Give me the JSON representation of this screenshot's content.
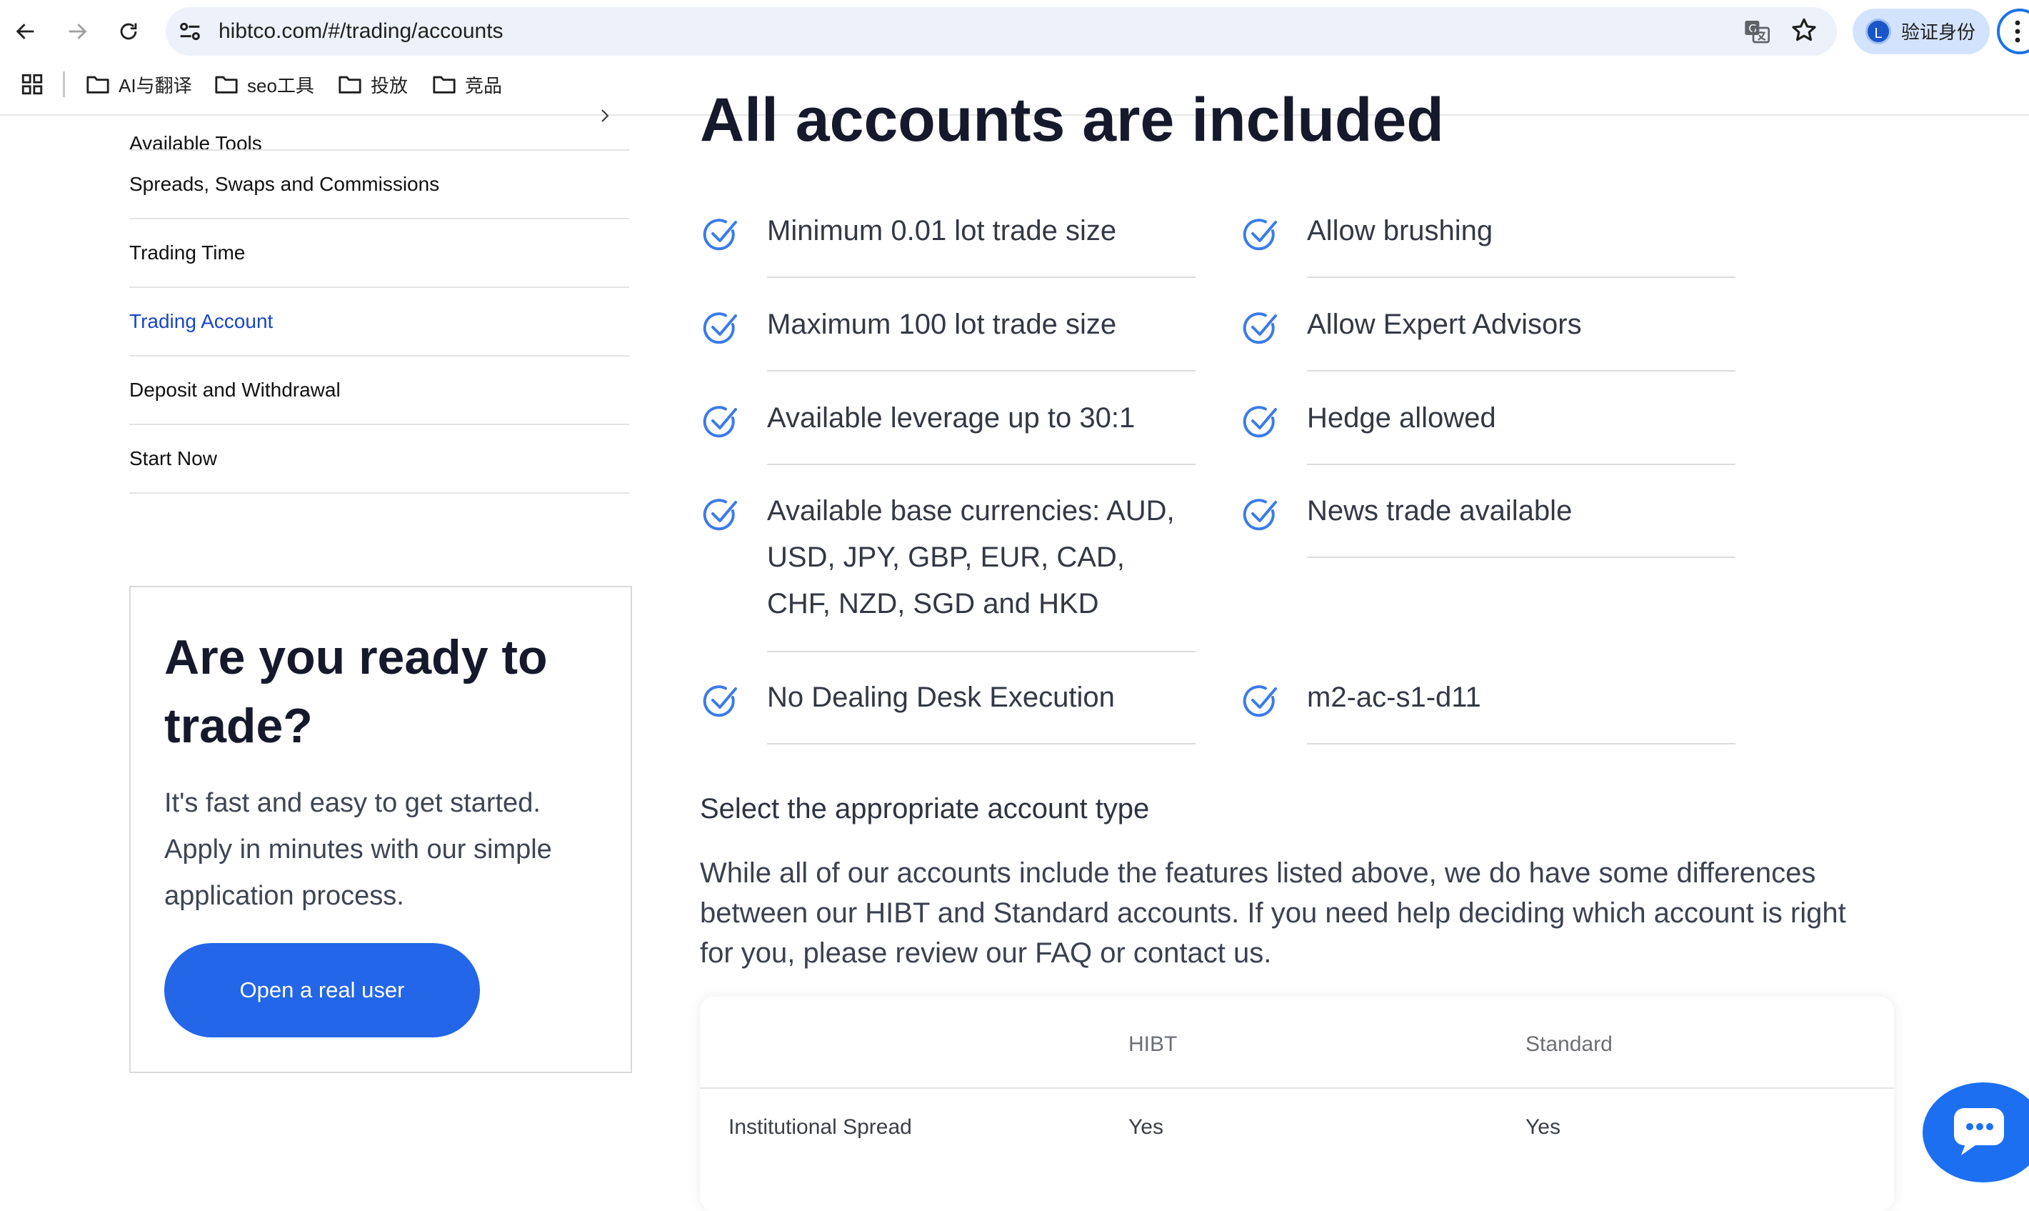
{
  "browser": {
    "url": "hibtco.com/#/trading/accounts",
    "profile_initial": "L",
    "profile_label": "验证身份",
    "bookmarks": [
      {
        "label": "AI与翻译"
      },
      {
        "label": "seo工具"
      },
      {
        "label": "投放"
      },
      {
        "label": "竞品"
      }
    ]
  },
  "sidebar": {
    "items": [
      {
        "label": "Available Tools"
      },
      {
        "label": "Spreads, Swaps and Commissions"
      },
      {
        "label": "Trading Time"
      },
      {
        "label": "Trading Account"
      },
      {
        "label": "Deposit and Withdrawal"
      },
      {
        "label": "Start Now"
      }
    ],
    "active_index": 3,
    "active_color": "#1846c8"
  },
  "cta": {
    "title": "Are you ready to trade?",
    "text": "It's fast and easy to get started. Apply in minutes with our simple application process.",
    "button": "Open a real user"
  },
  "main": {
    "heading": "All accounts are included",
    "features_left": [
      "Minimum 0.01 lot trade size",
      "Maximum 100 lot trade size",
      "Available leverage up to 30:1",
      "Available base currencies: AUD, USD, JPY, GBP, EUR, CAD, CHF, NZD, SGD and HKD",
      "No Dealing Desk Execution"
    ],
    "features_right": [
      "Allow brushing",
      "Allow Expert Advisors",
      "Hedge allowed",
      "News trade available",
      "m2-ac-s1-d11"
    ],
    "select_title": "Select the appropriate account type",
    "select_body": "While all of our accounts include the features listed above, we do have some differences between our HIBT and Standard accounts. If you need help deciding which account is right for you, please review our FAQ or contact us."
  },
  "table": {
    "columns": [
      "",
      "HIBT",
      "Standard"
    ],
    "rows": [
      {
        "label": "Institutional Spread",
        "hibt": "Yes",
        "standard": "Yes"
      }
    ]
  },
  "colors": {
    "accent": "#2366e8",
    "check": "#3b7be8",
    "heading": "#15192b"
  }
}
